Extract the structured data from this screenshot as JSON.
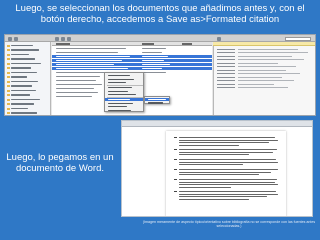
{
  "slide": {
    "top_caption": "Luego, se seleccionan los documentos que añadimos antes y, con el botón derecho, accedemos a Save as>Formated citation",
    "left_caption": "Luego, lo pegamos en un documento de Word.",
    "credit": "(Imagen meramente de aspecto típico/orientativo sobre bibliografía no se corresponde con las fuentes antes seleccionadas.)"
  },
  "zotero": {
    "toolbar_icons": [
      "new-collection-icon",
      "new-group-icon",
      "add-item-icon",
      "attach-icon",
      "note-icon",
      "sync-icon"
    ],
    "collections_count_rows": 16,
    "items_rows": 13,
    "selected_rows": [
      2,
      3,
      4,
      5
    ],
    "context_menu_items": 11,
    "highlighted_menu_item": 7,
    "colors": {
      "selection": "#3875d7",
      "folder": "#e6b94d",
      "note": "#f7e9a8"
    }
  },
  "word": {
    "references": 6
  },
  "colors": {
    "background": "#2f78c6"
  }
}
